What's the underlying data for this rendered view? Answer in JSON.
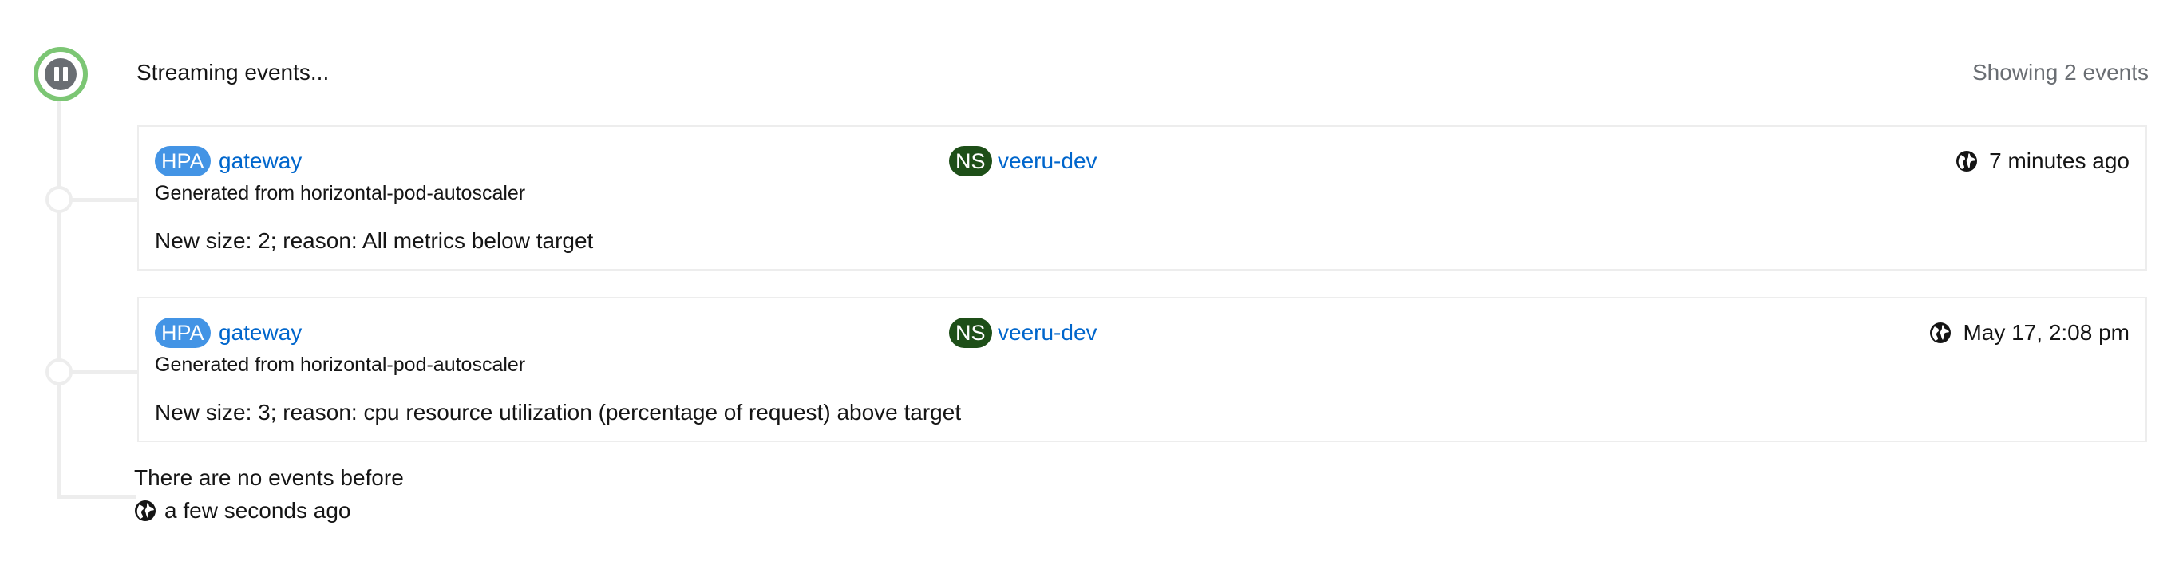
{
  "header": {
    "status_text": "Streaming events...",
    "events_count": "Showing 2 events"
  },
  "events": [
    {
      "kind": "HPA",
      "resource": "gateway",
      "namespace_kind": "NS",
      "namespace": "veeru-dev",
      "time": "7 minutes ago",
      "source": "Generated from horizontal-pod-autoscaler",
      "message": "New size: 2; reason: All metrics below target"
    },
    {
      "kind": "HPA",
      "resource": "gateway",
      "namespace_kind": "NS",
      "namespace": "veeru-dev",
      "time": "May 17, 2:08 pm",
      "source": "Generated from horizontal-pod-autoscaler",
      "message": "New size: 3; reason: cpu resource utilization (percentage of request) above target"
    }
  ],
  "footer": {
    "no_events_text": "There are no events before",
    "time": "a few seconds ago"
  },
  "colors": {
    "stream_ring": "#7cc674",
    "hpa_badge": "#4394e5",
    "ns_badge": "#1e4f18",
    "link": "#0066cc"
  },
  "icons": {
    "pause": "pause-icon",
    "globe": "globe-icon"
  }
}
